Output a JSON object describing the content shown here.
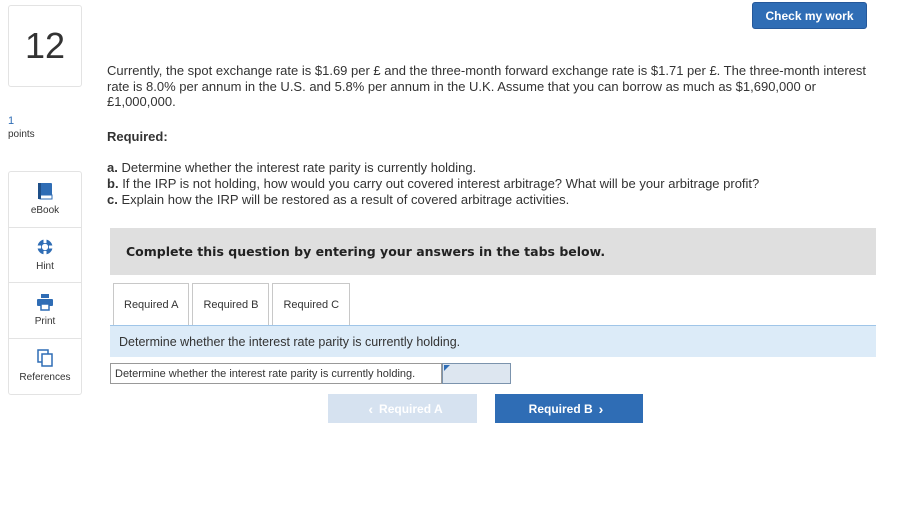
{
  "header": {
    "check_label": "Check my work"
  },
  "question": {
    "number": "12",
    "points_value": "1",
    "points_label": "points",
    "text": "Currently, the spot exchange rate is $1.69 per £ and the three-month forward exchange rate is $1.71 per £. The three-month interest rate is 8.0% per annum in the U.S. and 5.8% per annum in the U.K. Assume that you can borrow as much as $1,690,000 or £1,000,000.",
    "required_heading": "Required:",
    "parts": [
      {
        "letter": "a.",
        "text": "Determine whether the interest rate parity is currently holding."
      },
      {
        "letter": "b.",
        "text": "If the IRP is not holding, how would you carry out covered interest arbitrage? What will be your arbitrage profit?"
      },
      {
        "letter": "c.",
        "text": "Explain how the IRP will be restored as a result of covered arbitrage activities."
      }
    ]
  },
  "sidebar": {
    "tools": [
      {
        "label": "eBook",
        "icon": "book-icon"
      },
      {
        "label": "Hint",
        "icon": "lifebuoy-icon"
      },
      {
        "label": "Print",
        "icon": "printer-icon"
      },
      {
        "label": "References",
        "icon": "documents-icon"
      }
    ]
  },
  "main": {
    "complete_text": "Complete this question by entering your answers in the tabs below.",
    "tabs": [
      {
        "label": "Required A"
      },
      {
        "label": "Required B"
      },
      {
        "label": "Required C"
      }
    ],
    "instruction": "Determine whether the interest rate parity is currently holding.",
    "answer_label": "Determine whether the interest rate parity is currently holding.",
    "answer_value": "",
    "prev_label": "Required A",
    "next_label": "Required B"
  },
  "colors": {
    "accent": "#2f6db5",
    "instruction_bg": "#dcebf8",
    "complete_bg": "#dfdfdf"
  }
}
